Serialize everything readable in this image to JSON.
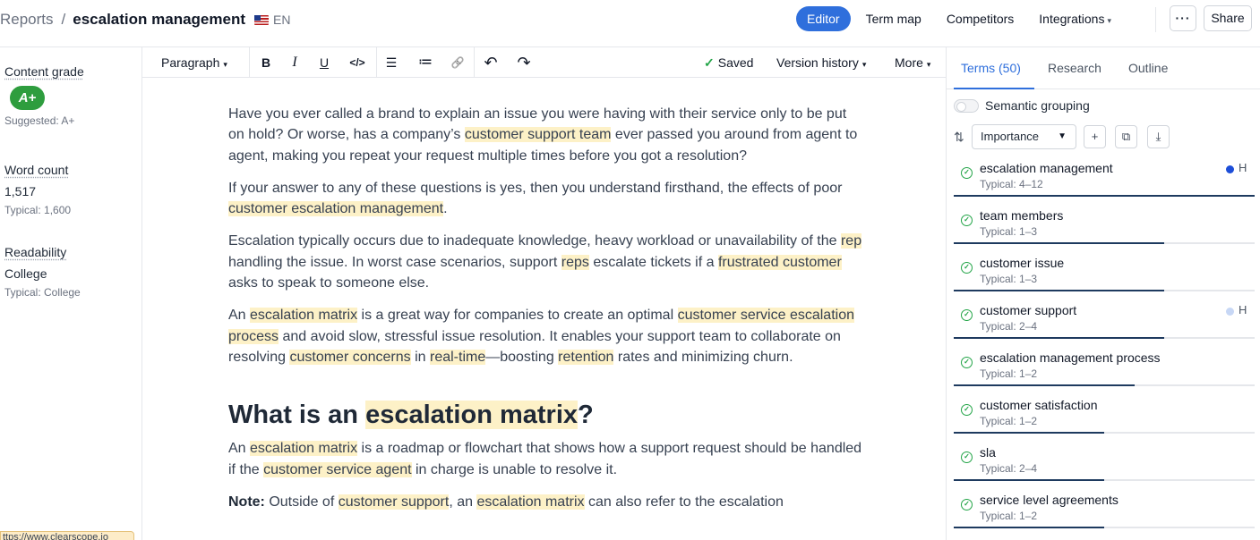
{
  "header": {
    "breadcrumb_root": "Reports",
    "breadcrumb_sep": "/",
    "doc_title": "escalation management",
    "language": "EN",
    "nav": [
      "Editor",
      "Term map",
      "Competitors",
      "Integrations"
    ],
    "more_label": "···",
    "share_label": "Share"
  },
  "left": {
    "grade_title": "Content grade",
    "grade_value": "A+",
    "grade_suggested": "Suggested: A+",
    "word_title": "Word count",
    "word_value": "1,517",
    "word_typical": "Typical: 1,600",
    "read_title": "Readability",
    "read_value": "College",
    "read_typical": "Typical: College",
    "status_url": "ttps://www.clearscope.io"
  },
  "toolbar": {
    "paragraph": "Paragraph",
    "bold": "B",
    "italic": "I",
    "underline": "U",
    "code": "</>",
    "bullets": "☰",
    "numbered": "≔",
    "link": "🔗",
    "undo": "↶",
    "redo": "↷",
    "saved": "Saved",
    "version_history": "Version history",
    "more": "More"
  },
  "editor": {
    "p1": {
      "a": "Have you ever called a brand to explain an issue you were having with their service only to be put on hold? Or worse, has a company’s ",
      "h1": "customer support team",
      "b": " ever passed you around from agent to agent, making you repeat your request multiple times before you got a resolution?"
    },
    "p2": {
      "a": "If your answer to any of these questions is yes, then you understand firsthand, the effects of poor ",
      "h1": "customer escalation management",
      "b": "."
    },
    "p3": {
      "a": "Escalation typically occurs due to inadequate knowledge, heavy workload or unavailability of the ",
      "h1": "rep",
      "b": " handling the issue. In worst case scenarios, support ",
      "h2": "reps",
      "c": " escalate tickets if a ",
      "h3": "frustrated customer",
      "d": " asks to speak to someone else."
    },
    "p4": {
      "a": "An ",
      "h1": "escalation matrix",
      "b": " is a great way for companies to create an optimal ",
      "h2": "customer service escalation process",
      "c": " and avoid slow, stressful issue resolution. It enables your support team to collaborate on resolving ",
      "h3": "customer concerns",
      "d": " in ",
      "h4": "real-time",
      "e": "—boosting ",
      "h5": "retention",
      "f": " rates and minimizing churn."
    },
    "h2": {
      "a": "What is an ",
      "h1": "escalation matrix",
      "b": "?"
    },
    "p5": {
      "a": "An ",
      "h1": "escalation matrix",
      "b": " is a roadmap or flowchart that shows how a support request should be handled if the ",
      "h2": "customer service agent",
      "c": " in charge is unable to resolve it."
    },
    "p6": {
      "bold": "Note:",
      "a": " Outside of ",
      "h1": "customer support",
      "b": ", an ",
      "h2": "escalation matrix",
      "c": " can also refer to the escalation"
    }
  },
  "right": {
    "tabs": [
      "Terms (50)",
      "Research",
      "Outline"
    ],
    "grouping_label": "Semantic grouping",
    "sort_value": "Importance",
    "add_label": "+",
    "copy_label": "⧉",
    "download_label": "⤓",
    "terms": [
      {
        "name": "escalation management",
        "typical": "Typical: 4–12",
        "progress": 1.0,
        "heading": "H",
        "dot_color": "#1d4ed8"
      },
      {
        "name": "team members",
        "typical": "Typical: 1–3",
        "progress": 0.7,
        "heading": "",
        "dot_color": ""
      },
      {
        "name": "customer issue",
        "typical": "Typical: 1–3",
        "progress": 0.7,
        "heading": "",
        "dot_color": ""
      },
      {
        "name": "customer support",
        "typical": "Typical: 2–4",
        "progress": 0.7,
        "heading": "H",
        "dot_color": "#c7d7f5"
      },
      {
        "name": "escalation management process",
        "typical": "Typical: 1–2",
        "progress": 0.6,
        "heading": "",
        "dot_color": ""
      },
      {
        "name": "customer satisfaction",
        "typical": "Typical: 1–2",
        "progress": 0.5,
        "heading": "",
        "dot_color": ""
      },
      {
        "name": "sla",
        "typical": "Typical: 2–4",
        "progress": 0.5,
        "heading": "",
        "dot_color": ""
      },
      {
        "name": "service level agreements",
        "typical": "Typical: 1–2",
        "progress": 0.5,
        "heading": "",
        "dot_color": ""
      }
    ]
  },
  "colors": {
    "accent": "#2f6fdc",
    "grade": "#2e9d3e",
    "highlight": "#fdf1c7",
    "progress": "#1e3a5f"
  }
}
